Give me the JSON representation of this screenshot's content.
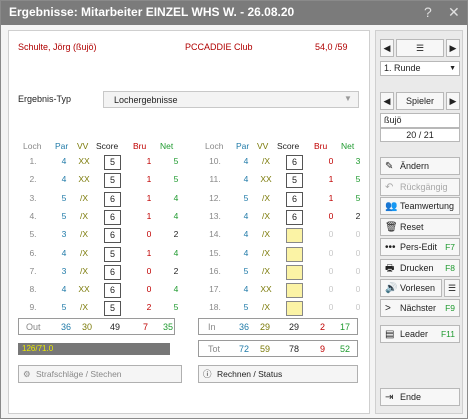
{
  "window": {
    "title": "Ergebnisse: Mitarbeiter EINZEL WHS W. - 26.08.20",
    "help": "?",
    "close": "✕"
  },
  "player": {
    "name": "Schulte, Jörg (ßujö)",
    "club": "PCCADDIE Club",
    "hcp": "54,0 /59"
  },
  "ergebnis": {
    "label": "Ergebnis-Typ",
    "value": "Lochergebnisse"
  },
  "columns": {
    "loch": "Loch",
    "par": "Par",
    "vv": "VV",
    "score": "Score",
    "bru": "Bru",
    "net": "Net"
  },
  "front": [
    {
      "loch": "1.",
      "par": "4",
      "vv": "XX",
      "score": "5",
      "bru": "1",
      "net": "5"
    },
    {
      "loch": "2.",
      "par": "4",
      "vv": "XX",
      "score": "5",
      "bru": "1",
      "net": "5"
    },
    {
      "loch": "3.",
      "par": "5",
      "vv": "/X",
      "score": "6",
      "bru": "1",
      "net": "4"
    },
    {
      "loch": "4.",
      "par": "5",
      "vv": "/X",
      "score": "6",
      "bru": "1",
      "net": "4"
    },
    {
      "loch": "5.",
      "par": "3",
      "vv": "/X",
      "score": "6",
      "bru": "0",
      "net": "2"
    },
    {
      "loch": "6.",
      "par": "4",
      "vv": "/X",
      "score": "5",
      "bru": "1",
      "net": "4"
    },
    {
      "loch": "7.",
      "par": "3",
      "vv": "/X",
      "score": "6",
      "bru": "0",
      "net": "2"
    },
    {
      "loch": "8.",
      "par": "4",
      "vv": "XX",
      "score": "6",
      "bru": "0",
      "net": "4"
    },
    {
      "loch": "9.",
      "par": "5",
      "vv": "/X",
      "score": "5",
      "bru": "2",
      "net": "5"
    }
  ],
  "back": [
    {
      "loch": "10.",
      "par": "4",
      "vv": "/X",
      "score": "6",
      "bru": "0",
      "net": "3"
    },
    {
      "loch": "11.",
      "par": "4",
      "vv": "XX",
      "score": "5",
      "bru": "1",
      "net": "5"
    },
    {
      "loch": "12.",
      "par": "5",
      "vv": "/X",
      "score": "6",
      "bru": "1",
      "net": "5"
    },
    {
      "loch": "13.",
      "par": "4",
      "vv": "/X",
      "score": "6",
      "bru": "0",
      "net": "2"
    },
    {
      "loch": "14.",
      "par": "4",
      "vv": "/X",
      "score": "",
      "bru": "0",
      "net": "0"
    },
    {
      "loch": "15.",
      "par": "4",
      "vv": "/X",
      "score": "",
      "bru": "0",
      "net": "0"
    },
    {
      "loch": "16.",
      "par": "5",
      "vv": "/X",
      "score": "",
      "bru": "0",
      "net": "0"
    },
    {
      "loch": "17.",
      "par": "4",
      "vv": "XX",
      "score": "",
      "bru": "0",
      "net": "0"
    },
    {
      "loch": "18.",
      "par": "5",
      "vv": "/X",
      "score": "",
      "bru": "0",
      "net": "0"
    }
  ],
  "totals": {
    "out": {
      "label": "Out",
      "par": "36",
      "vv": "30",
      "score": "49",
      "bru": "7",
      "net": "35"
    },
    "in": {
      "label": "In",
      "par": "36",
      "vv": "29",
      "score": "29",
      "bru": "2",
      "net": "17"
    },
    "tot": {
      "label": "Tot",
      "par": "72",
      "vv": "59",
      "score": "78",
      "bru": "9",
      "net": "52"
    }
  },
  "hcp_bar": "126/71.0",
  "buttons": {
    "strafschlaege": "Strafschläge / Stechen",
    "rechnen": "Rechnen / Status"
  },
  "side": {
    "runde": "1. Runde",
    "spieler_label": "Spieler",
    "player_short": "ßujö",
    "count": "20 / 21",
    "aendern": "Ändern",
    "rueckgaengig": "Rückgängig",
    "teamwertung": "Teamwertung",
    "reset": "Reset",
    "pers_edit": "Pers-Edit",
    "pers_edit_key": "F7",
    "drucken": "Drucken",
    "drucken_key": "F8",
    "vorlesen": "Vorlesen",
    "naechster": "Nächster",
    "naechster_key": "F9",
    "leader": "Leader",
    "leader_key": "F11",
    "ende": "Ende"
  }
}
